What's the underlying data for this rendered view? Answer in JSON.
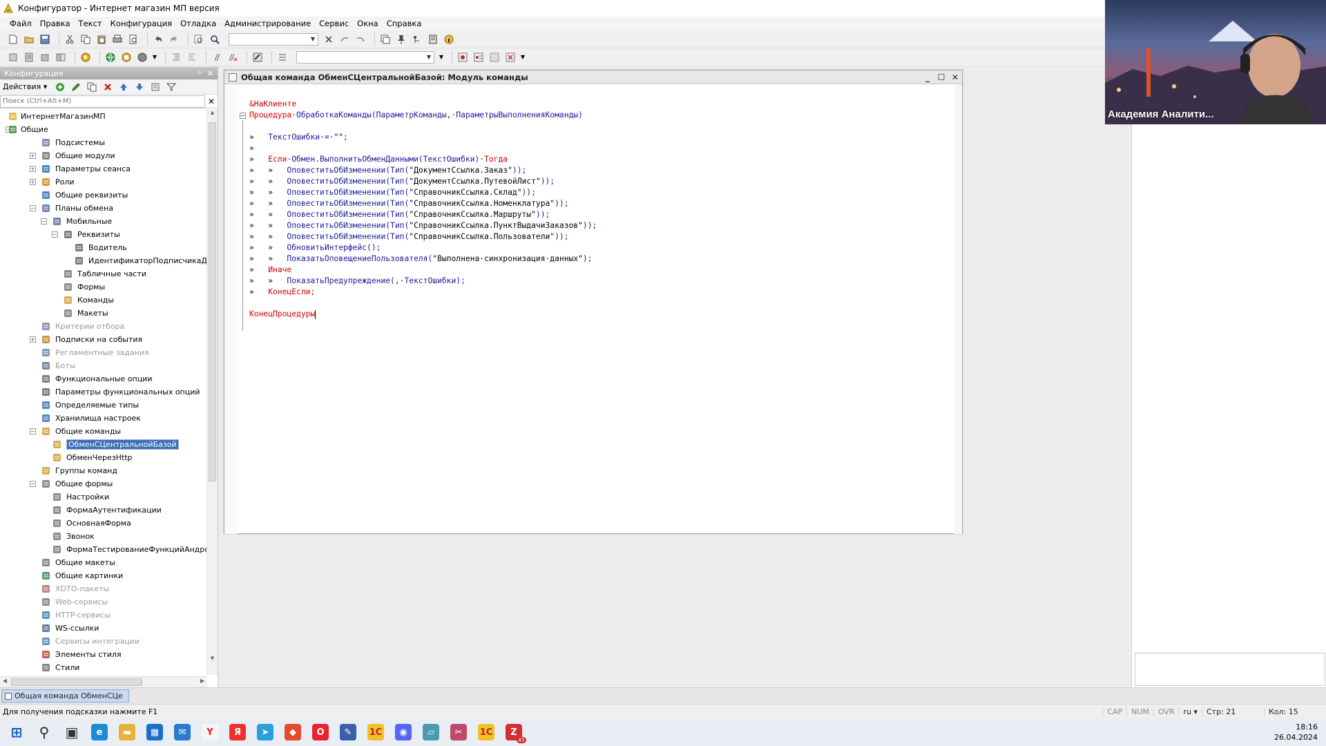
{
  "window": {
    "title": "Конфигуратор - Интернет магазин МП версия"
  },
  "menu": [
    "Файл",
    "Правка",
    "Текст",
    "Конфигурация",
    "Отладка",
    "Администрирование",
    "Сервис",
    "Окна",
    "Справка"
  ],
  "left_panel": {
    "title": "Конфигурация",
    "actions_label": "Действия ▾",
    "search_placeholder": "Поиск (Ctrl+Alt+M)",
    "tree": [
      {
        "label": "ИнтернетМагазинМП",
        "level": 0,
        "icon": "config-root-icon",
        "color": "#e0b030",
        "exp": ""
      },
      {
        "label": "Общие",
        "level": 0,
        "icon": "common-icon",
        "color": "#4a8a3a",
        "exp": "−"
      },
      {
        "label": "Подсистемы",
        "level": 1,
        "icon": "subsystems-icon",
        "color": "#6a7ab0",
        "exp": ""
      },
      {
        "label": "Общие модули",
        "level": 1,
        "icon": "module-icon",
        "color": "#707070",
        "exp": "+"
      },
      {
        "label": "Параметры сеанса",
        "level": 1,
        "icon": "session-params-icon",
        "color": "#2f6fb8",
        "exp": "+"
      },
      {
        "label": "Роли",
        "level": 1,
        "icon": "roles-icon",
        "color": "#d08a20",
        "exp": "+"
      },
      {
        "label": "Общие реквизиты",
        "level": 1,
        "icon": "attribute-icon",
        "color": "#3a70b0",
        "exp": ""
      },
      {
        "label": "Планы обмена",
        "level": 1,
        "icon": "exchange-plan-icon",
        "color": "#5a6fa0",
        "exp": "−"
      },
      {
        "label": "Мобильные",
        "level": 2,
        "icon": "exchange-plan-icon",
        "color": "#5a6fa0",
        "exp": "−"
      },
      {
        "label": "Реквизиты",
        "level": 3,
        "icon": "attribute-icon",
        "color": "#666",
        "exp": "−"
      },
      {
        "label": "Водитель",
        "level": 4,
        "icon": "attribute-icon",
        "color": "#666",
        "exp": ""
      },
      {
        "label": "ИдентификаторПодписчикаДостав",
        "level": 4,
        "icon": "attribute-icon",
        "color": "#666",
        "exp": ""
      },
      {
        "label": "Табличные части",
        "level": 3,
        "icon": "table-part-icon",
        "color": "#777",
        "exp": ""
      },
      {
        "label": "Формы",
        "level": 3,
        "icon": "form-icon",
        "color": "#777",
        "exp": ""
      },
      {
        "label": "Команды",
        "level": 3,
        "icon": "command-icon",
        "color": "#d0a030",
        "exp": ""
      },
      {
        "label": "Макеты",
        "level": 3,
        "icon": "template-icon",
        "color": "#777",
        "exp": ""
      },
      {
        "label": "Критерии отбора",
        "level": 1,
        "icon": "filter-criteria-icon",
        "color": "#8a7ab0",
        "exp": "",
        "dim": true
      },
      {
        "label": "Подписки на события",
        "level": 1,
        "icon": "event-subscription-icon",
        "color": "#c08030",
        "exp": "+"
      },
      {
        "label": "Регламентные задания",
        "level": 1,
        "icon": "scheduled-jobs-icon",
        "color": "#6a8ab0",
        "exp": "",
        "dim": true
      },
      {
        "label": "Боты",
        "level": 1,
        "icon": "bots-icon",
        "color": "#607090",
        "exp": "",
        "dim": true
      },
      {
        "label": "Функциональные опции",
        "level": 1,
        "icon": "functional-options-icon",
        "color": "#666",
        "exp": ""
      },
      {
        "label": "Параметры функциональных опций",
        "level": 1,
        "icon": "functional-params-icon",
        "color": "#666",
        "exp": ""
      },
      {
        "label": "Определяемые типы",
        "level": 1,
        "icon": "defined-types-icon",
        "color": "#3a70b0",
        "exp": ""
      },
      {
        "label": "Хранилища настроек",
        "level": 1,
        "icon": "settings-storage-icon",
        "color": "#3a70b0",
        "exp": ""
      },
      {
        "label": "Общие команды",
        "level": 1,
        "icon": "command-icon",
        "color": "#d0a030",
        "exp": "−"
      },
      {
        "label": "ОбменСЦентральнойБазой",
        "level": 2,
        "icon": "command-icon",
        "color": "#d0a030",
        "exp": "",
        "selected": true
      },
      {
        "label": "ОбменЧерезHttp",
        "level": 2,
        "icon": "command-icon",
        "color": "#d0a030",
        "exp": ""
      },
      {
        "label": "Группы команд",
        "level": 1,
        "icon": "command-group-icon",
        "color": "#d0a030",
        "exp": ""
      },
      {
        "label": "Общие формы",
        "level": 1,
        "icon": "form-icon",
        "color": "#777",
        "exp": "−"
      },
      {
        "label": "Настройки",
        "level": 2,
        "icon": "form-icon",
        "color": "#777",
        "exp": ""
      },
      {
        "label": "ФормаАутентификации",
        "level": 2,
        "icon": "form-icon",
        "color": "#777",
        "exp": ""
      },
      {
        "label": "ОсновнаяФорма",
        "level": 2,
        "icon": "form-icon",
        "color": "#777",
        "exp": ""
      },
      {
        "label": "Звонок",
        "level": 2,
        "icon": "form-icon",
        "color": "#777",
        "exp": ""
      },
      {
        "label": "ФормаТестированиеФункцийАндроид",
        "level": 2,
        "icon": "form-icon",
        "color": "#777",
        "exp": ""
      },
      {
        "label": "Общие макеты",
        "level": 1,
        "icon": "template-icon",
        "color": "#777",
        "exp": ""
      },
      {
        "label": "Общие картинки",
        "level": 1,
        "icon": "picture-icon",
        "color": "#3a8a5a",
        "exp": ""
      },
      {
        "label": "XDTO-пакеты",
        "level": 1,
        "icon": "xdto-icon",
        "color": "#b07070",
        "exp": "",
        "dim": true
      },
      {
        "label": "Web-сервисы",
        "level": 1,
        "icon": "web-service-icon",
        "color": "#7a7a7a",
        "exp": "",
        "dim": true
      },
      {
        "label": "HTTP-сервисы",
        "level": 1,
        "icon": "http-service-icon",
        "color": "#3a80b0",
        "exp": "",
        "dim": true
      },
      {
        "label": "WS-ссылки",
        "level": 1,
        "icon": "ws-link-icon",
        "color": "#4a6a90",
        "exp": ""
      },
      {
        "label": "Сервисы интеграции",
        "level": 1,
        "icon": "integration-icon",
        "color": "#4a8ab0",
        "exp": "",
        "dim": true
      },
      {
        "label": "Элементы стиля",
        "level": 1,
        "icon": "style-item-icon",
        "color": "#c04040",
        "exp": ""
      },
      {
        "label": "Стили",
        "level": 1,
        "icon": "style-icon",
        "color": "#707070",
        "exp": ""
      }
    ]
  },
  "code_window": {
    "title": "Общая команда ОбменСЦентральнойБазой: Модуль команды",
    "lines": [
      [
        {
          "t": "&НаКлиенте",
          "c": "kw"
        }
      ],
      [
        {
          "t": "Процедура",
          "c": "kw"
        },
        {
          "t": "·ОбработкаКоманды(ПараметрКоманды,·ПараметрыВыполненияКоманды)",
          "c": ""
        }
      ],
      [],
      [
        {
          "t": "»   ",
          "c": "str"
        },
        {
          "t": "ТекстОшибки·=·",
          "c": ""
        },
        {
          "t": "\"\"",
          "c": "str"
        },
        {
          "t": ";",
          "c": ""
        }
      ],
      [
        {
          "t": "»",
          "c": "str"
        }
      ],
      [
        {
          "t": "»   ",
          "c": "str"
        },
        {
          "t": "Если",
          "c": "kw"
        },
        {
          "t": "·Обмен.ВыполнитьОбменДанными(ТекстОшибки)·",
          "c": ""
        },
        {
          "t": "Тогда",
          "c": "kw"
        }
      ],
      [
        {
          "t": "»   »   ",
          "c": "str"
        },
        {
          "t": "ОповеститьОбИзменении(Тип(",
          "c": ""
        },
        {
          "t": "\"ДокументСсылка.Заказ\"",
          "c": "str"
        },
        {
          "t": "));",
          "c": ""
        }
      ],
      [
        {
          "t": "»   »   ",
          "c": "str"
        },
        {
          "t": "ОповеститьОбИзменении(Тип(",
          "c": ""
        },
        {
          "t": "\"ДокументСсылка.ПутевойЛист\"",
          "c": "str"
        },
        {
          "t": "));",
          "c": ""
        }
      ],
      [
        {
          "t": "»   »   ",
          "c": "str"
        },
        {
          "t": "ОповеститьОбИзменении(Тип(",
          "c": ""
        },
        {
          "t": "\"СправочникСсылка.Склад\"",
          "c": "str"
        },
        {
          "t": "));",
          "c": ""
        }
      ],
      [
        {
          "t": "»   »   ",
          "c": "str"
        },
        {
          "t": "ОповеститьОбИзменении(Тип(",
          "c": ""
        },
        {
          "t": "\"СправочникСсылка.Номенклатура\"",
          "c": "str"
        },
        {
          "t": "));",
          "c": ""
        }
      ],
      [
        {
          "t": "»   »   ",
          "c": "str"
        },
        {
          "t": "ОповеститьОбИзменении(Тип(",
          "c": ""
        },
        {
          "t": "\"СправочникСсылка.Маршруты\"",
          "c": "str"
        },
        {
          "t": "));",
          "c": ""
        }
      ],
      [
        {
          "t": "»   »   ",
          "c": "str"
        },
        {
          "t": "ОповеститьОбИзменении(Тип(",
          "c": ""
        },
        {
          "t": "\"СправочникСсылка.ПунктВыдачиЗаказов\"",
          "c": "str"
        },
        {
          "t": "));",
          "c": ""
        }
      ],
      [
        {
          "t": "»   »   ",
          "c": "str"
        },
        {
          "t": "ОповеститьОбИзменении(Тип(",
          "c": ""
        },
        {
          "t": "\"СправочникСсылка.Пользователи\"",
          "c": "str"
        },
        {
          "t": "));",
          "c": ""
        }
      ],
      [
        {
          "t": "»   »   ",
          "c": "str"
        },
        {
          "t": "ОбновитьИнтерфейс();",
          "c": ""
        }
      ],
      [
        {
          "t": "»   »   ",
          "c": "str"
        },
        {
          "t": "ПоказатьОповещениеПользователя(",
          "c": ""
        },
        {
          "t": "\"Выполнена·синхронизация·данных\"",
          "c": "str"
        },
        {
          "t": ");",
          "c": ""
        }
      ],
      [
        {
          "t": "»   ",
          "c": "str"
        },
        {
          "t": "Иначе",
          "c": "kw"
        }
      ],
      [
        {
          "t": "»   »   ",
          "c": "str"
        },
        {
          "t": "ПоказатьПредупреждение(,·ТекстОшибки);",
          "c": ""
        }
      ],
      [
        {
          "t": "»   ",
          "c": "str"
        },
        {
          "t": "КонецЕсли;",
          "c": "kw"
        }
      ],
      [],
      [
        {
          "t": "КонецПроцедуры",
          "c": "kw"
        },
        {
          "t": "",
          "c": "cursor"
        }
      ]
    ]
  },
  "video_overlay": {
    "caption": "Академия Аналити..."
  },
  "window_tabs": [
    "Общая команда ОбменСЦе"
  ],
  "status_bar": {
    "hint": "Для получения подсказки нажмите F1",
    "cap": "CAP",
    "num": "NUM",
    "ovr": "OVR",
    "lang": "ru ▾",
    "line": "Стр: 21",
    "col": "Кол: 15"
  },
  "taskbar": {
    "time": "18:16",
    "date": "26.04.2024",
    "apps": [
      {
        "name": "windows-start-icon",
        "glyph": "⊞",
        "bg": "",
        "fg": "#0a5bb5"
      },
      {
        "name": "search-icon",
        "glyph": "⚲",
        "bg": "",
        "fg": "#222"
      },
      {
        "name": "task-view-icon",
        "glyph": "▣",
        "bg": "",
        "fg": "#333"
      },
      {
        "name": "edge-icon",
        "glyph": "e",
        "bg": "#1c8ad6",
        "fg": "#fff"
      },
      {
        "name": "file-explorer-icon",
        "glyph": "▬",
        "bg": "#e8b23a",
        "fg": "#fff"
      },
      {
        "name": "store-icon",
        "glyph": "▦",
        "bg": "#1b6fc7",
        "fg": "#fff"
      },
      {
        "name": "mail-icon",
        "glyph": "✉",
        "bg": "#2a7ad0",
        "fg": "#fff"
      },
      {
        "name": "yandex-browser-icon",
        "glyph": "Y",
        "bg": "#f5f5f5",
        "fg": "#e02020"
      },
      {
        "name": "yandex-icon",
        "glyph": "Я",
        "bg": "#f03030",
        "fg": "#fff"
      },
      {
        "name": "telegram-icon",
        "glyph": "➤",
        "bg": "#2aa0dc",
        "fg": "#fff"
      },
      {
        "name": "anydesk-icon",
        "glyph": "◆",
        "bg": "#e64a2e",
        "fg": "#fff"
      },
      {
        "name": "opera-icon",
        "glyph": "O",
        "bg": "#e8232b",
        "fg": "#fff"
      },
      {
        "name": "onec-designer-icon",
        "glyph": "✎",
        "bg": "#3a5ea8",
        "fg": "#fff"
      },
      {
        "name": "onec-icon",
        "glyph": "1С",
        "bg": "#f2c02a",
        "fg": "#c02020"
      },
      {
        "name": "discord-icon",
        "glyph": "◉",
        "bg": "#5865f2",
        "fg": "#fff"
      },
      {
        "name": "notes-icon",
        "glyph": "▱",
        "bg": "#4a9ab0",
        "fg": "#fff"
      },
      {
        "name": "snip-icon",
        "glyph": "✂",
        "bg": "#c04868",
        "fg": "#fff"
      },
      {
        "name": "onec-enterprise-icon",
        "glyph": "1С",
        "bg": "#f2c02a",
        "fg": "#c02020"
      },
      {
        "name": "zoom-icon",
        "glyph": "Z",
        "bg": "#d03030",
        "fg": "#fff",
        "badge": "45"
      }
    ]
  }
}
